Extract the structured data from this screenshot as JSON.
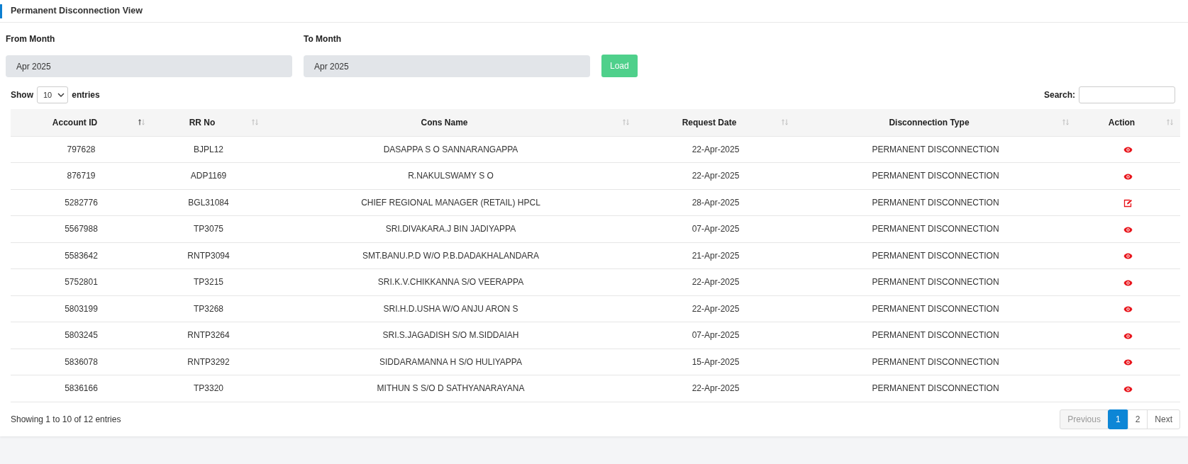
{
  "page_title": "Permanent Disconnection View",
  "filters": [
    {
      "label": "From Month",
      "value": "Apr 2025"
    },
    {
      "label": "To Month",
      "value": "Apr 2025"
    }
  ],
  "load_button": "Load",
  "length_menu": {
    "before": "Show",
    "value": "10",
    "after": "entries"
  },
  "search": {
    "label": "Search:"
  },
  "table": {
    "columns": [
      {
        "label": "Account ID",
        "sorted": true
      },
      {
        "label": "RR No",
        "sorted": false
      },
      {
        "label": "Cons Name",
        "sorted": false
      },
      {
        "label": "Request Date",
        "sorted": false
      },
      {
        "label": "Disconnection Type",
        "sorted": false
      },
      {
        "label": "Action",
        "sorted": false
      }
    ],
    "rows": [
      {
        "cells": [
          "797628",
          "BJPL12",
          "DASAPPA S O SANNARANGAPPA",
          "22-Apr-2025",
          "PERMANENT DISCONNECTION"
        ],
        "kind": "view"
      },
      {
        "cells": [
          "876719",
          "ADP1169",
          "R.NAKULSWAMY S O",
          "22-Apr-2025",
          "PERMANENT DISCONNECTION"
        ],
        "kind": "view"
      },
      {
        "cells": [
          "5282776",
          "BGL31084",
          "CHIEF REGIONAL MANAGER (RETAIL) HPCL",
          "28-Apr-2025",
          "PERMANENT DISCONNECTION"
        ],
        "kind": "edit"
      },
      {
        "cells": [
          "5567988",
          "TP3075",
          "SRI.DIVAKARA.J BIN JADIYAPPA",
          "07-Apr-2025",
          "PERMANENT DISCONNECTION"
        ],
        "kind": "view"
      },
      {
        "cells": [
          "5583642",
          "RNTP3094",
          "SMT.BANU.P.D W/O P.B.DADAKHALANDARA",
          "21-Apr-2025",
          "PERMANENT DISCONNECTION"
        ],
        "kind": "view"
      },
      {
        "cells": [
          "5752801",
          "TP3215",
          "SRI.K.V.CHIKKANNA S/O VEERAPPA",
          "22-Apr-2025",
          "PERMANENT DISCONNECTION"
        ],
        "kind": "view"
      },
      {
        "cells": [
          "5803199",
          "TP3268",
          "SRI.H.D.USHA W/O ANJU ARON S",
          "22-Apr-2025",
          "PERMANENT DISCONNECTION"
        ],
        "kind": "view"
      },
      {
        "cells": [
          "5803245",
          "RNTP3264",
          "SRI.S.JAGADISH S/O M.SIDDAIAH",
          "07-Apr-2025",
          "PERMANENT DISCONNECTION"
        ],
        "kind": "view"
      },
      {
        "cells": [
          "5836078",
          "RNTP3292",
          "SIDDARAMANNA H S/O HULIYAPPA",
          "15-Apr-2025",
          "PERMANENT DISCONNECTION"
        ],
        "kind": "view"
      },
      {
        "cells": [
          "5836166",
          "TP3320",
          "MITHUN S S/O D SATHYANARAYANA",
          "22-Apr-2025",
          "PERMANENT DISCONNECTION"
        ],
        "kind": "view"
      }
    ]
  },
  "info": "Showing 1 to 10 of 12 entries",
  "pagination": [
    {
      "label": "Previous",
      "disabled": true,
      "selected": false
    },
    {
      "label": "1",
      "disabled": false,
      "selected": true
    },
    {
      "label": "2",
      "disabled": false,
      "selected": false
    },
    {
      "label": "Next",
      "disabled": false,
      "selected": false
    }
  ]
}
